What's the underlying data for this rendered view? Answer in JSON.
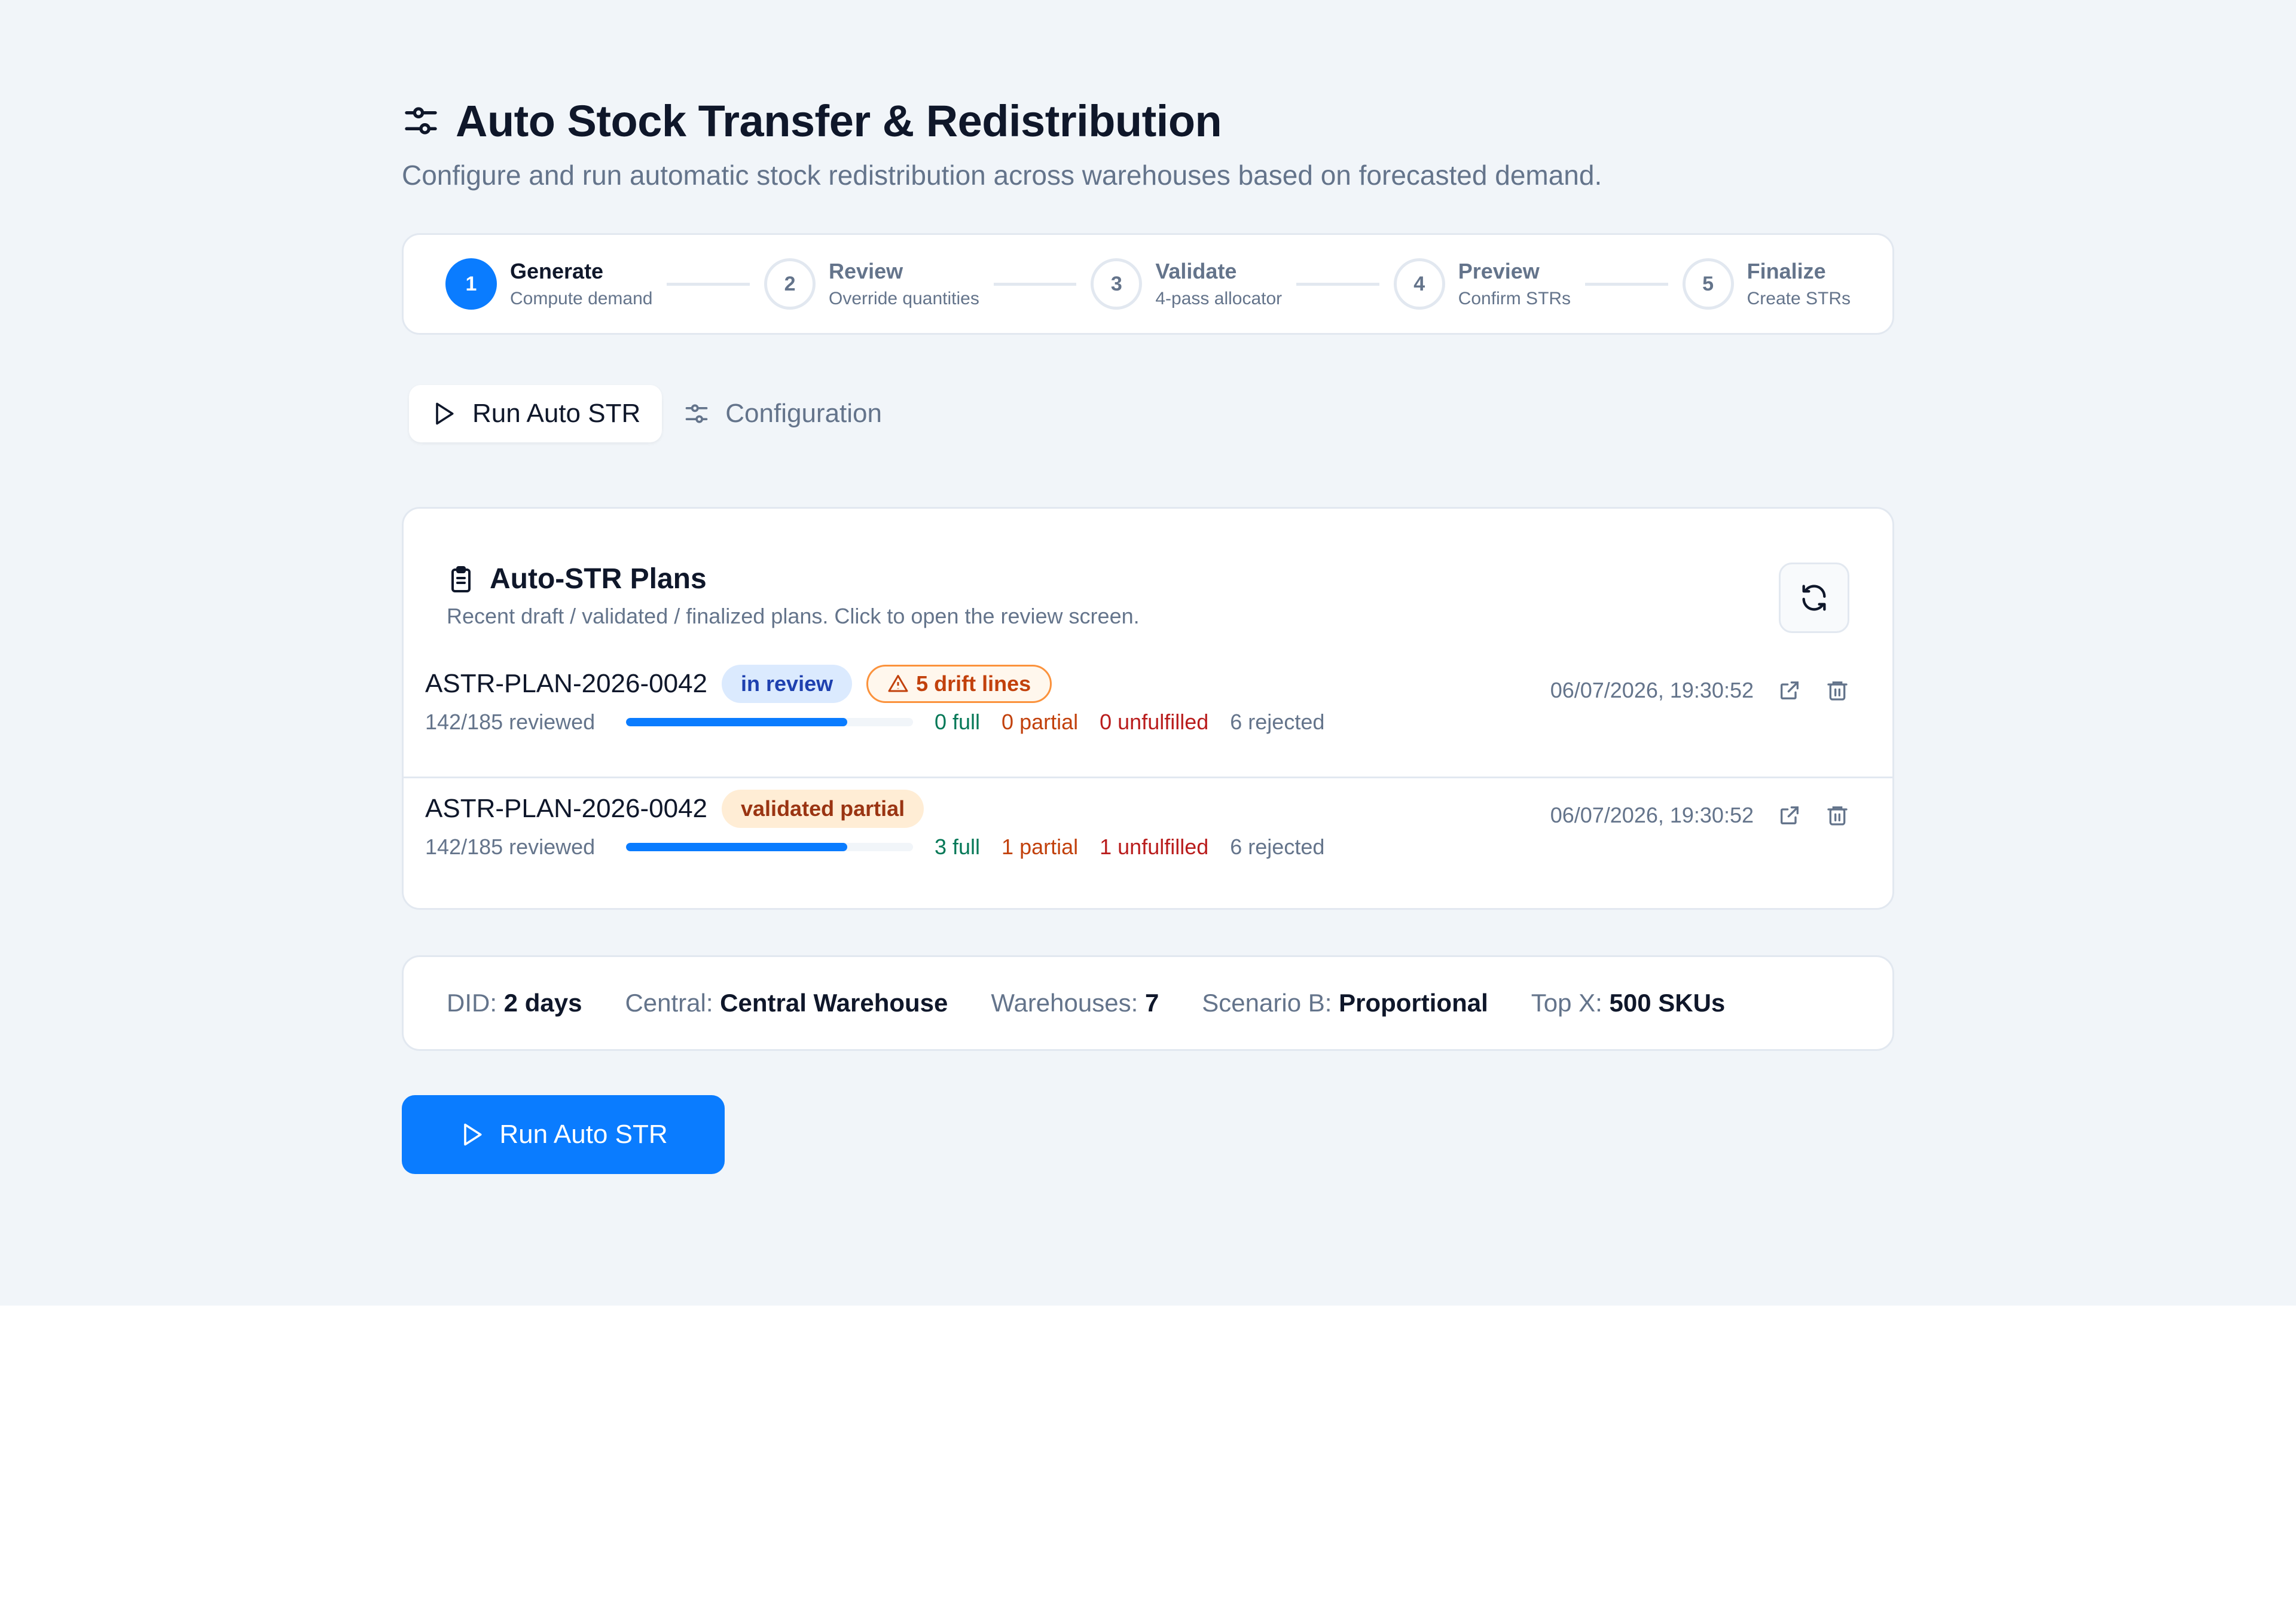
{
  "header": {
    "title": "Auto Stock Transfer & Redistribution",
    "subtitle": "Configure and run automatic stock redistribution across warehouses based on forecasted demand.",
    "icon": "sliders-icon"
  },
  "stepper": [
    {
      "number": "1",
      "label": "Generate",
      "desc": "Compute demand",
      "active": true
    },
    {
      "number": "2",
      "label": "Review",
      "desc": "Override quantities",
      "active": false
    },
    {
      "number": "3",
      "label": "Validate",
      "desc": "4-pass allocator",
      "active": false
    },
    {
      "number": "4",
      "label": "Preview",
      "desc": "Confirm STRs",
      "active": false
    },
    {
      "number": "5",
      "label": "Finalize",
      "desc": "Create STRs",
      "active": false
    }
  ],
  "tabs": [
    {
      "label": "Run Auto STR",
      "icon": "play-icon",
      "active": true
    },
    {
      "label": "Configuration",
      "icon": "sliders-icon",
      "active": false
    }
  ],
  "plans": {
    "title": "Auto-STR Plans",
    "subtitle": "Recent draft / validated / finalized plans. Click to open the review screen.",
    "rows": [
      {
        "id": "ASTR-PLAN-2026-0042",
        "status": "in review",
        "drift": "5 drift lines",
        "timestamp": "06/07/2026, 19:30:52",
        "reviewed": "142/185 reviewed",
        "progress": 0.77,
        "full": "0 full",
        "partial": "0 partial",
        "unfulfilled": "0 unfulfilled",
        "rejected": "6 rejected"
      },
      {
        "id": "ASTR-PLAN-2026-0042",
        "status": "validated partial",
        "drift": "",
        "timestamp": "06/07/2026, 19:30:52",
        "reviewed": "142/185 reviewed",
        "progress": 0.77,
        "full": "3 full",
        "partial": "1 partial",
        "unfulfilled": "1 unfulfilled",
        "rejected": "6 rejected"
      }
    ]
  },
  "summary": {
    "did_label": "DID:",
    "did_value": "2 days",
    "central_label": "Central:",
    "central_value": "Central Warehouse",
    "warehouses_label": "Warehouses:",
    "warehouses_value": "7",
    "scenario_label": "Scenario B:",
    "scenario_value": "Proportional",
    "topx_label": "Top X:",
    "topx_value": "500 SKUs"
  },
  "run_button": {
    "label": "Run Auto STR"
  },
  "colors": {
    "accent": "#0a7cff",
    "bg": "#f1f5f9",
    "border": "#e2e8f0"
  }
}
